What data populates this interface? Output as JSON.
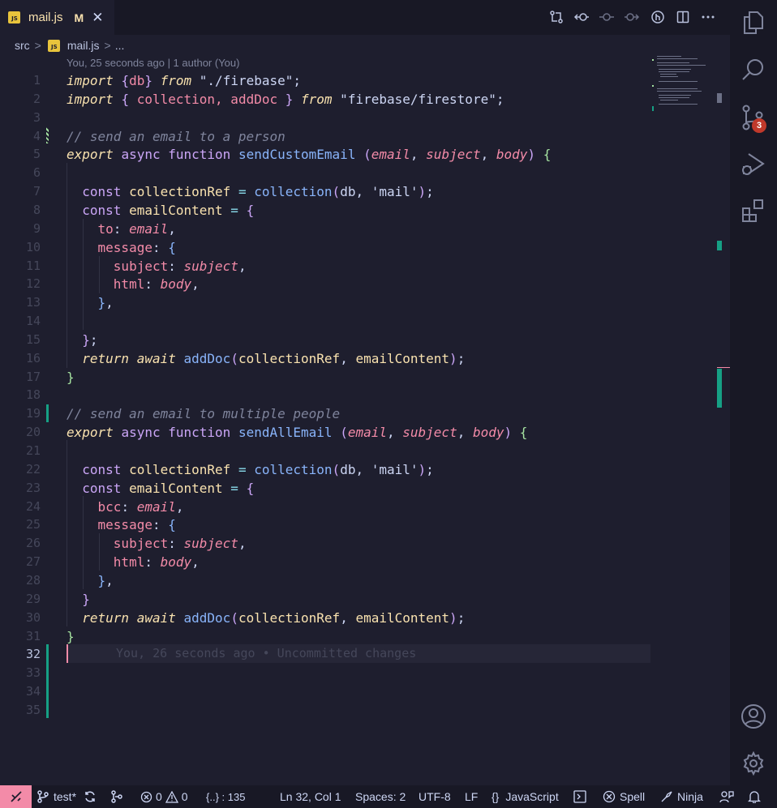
{
  "tab": {
    "badge": "JS",
    "name": "mail.js",
    "modified": "M",
    "close": "✕"
  },
  "toolbar": [
    "compare-changes",
    "open-changes",
    "previous-change",
    "next-change",
    "git-lens",
    "split-editor",
    "more-actions"
  ],
  "breadcrumb": {
    "folder": "src",
    "sep": ">",
    "file": "mail.js",
    "sep2": ">",
    "more": "..."
  },
  "blame_header": "You, 25 seconds ago | 1 author (You)",
  "inline_blame": "You, 26 seconds ago • Uncommitted changes",
  "lines": [
    {
      "n": "1",
      "t": [
        [
          "import",
          "kw"
        ],
        [
          " ",
          "p"
        ],
        [
          "{",
          "br1"
        ],
        [
          "db",
          "var"
        ],
        [
          "}",
          "br1"
        ],
        [
          " ",
          "p"
        ],
        [
          "from",
          "kw"
        ],
        [
          " \"./firebase\"",
          "str"
        ],
        [
          ";",
          "p"
        ]
      ]
    },
    {
      "n": "2",
      "t": [
        [
          "import",
          "kw"
        ],
        [
          " ",
          "p"
        ],
        [
          "{",
          "br1"
        ],
        [
          " collection, addDoc ",
          "var"
        ],
        [
          "}",
          "br1"
        ],
        [
          " ",
          "p"
        ],
        [
          "from",
          "kw"
        ],
        [
          " \"firebase/firestore\"",
          "str"
        ],
        [
          ";",
          "p"
        ]
      ]
    },
    {
      "n": "3",
      "t": []
    },
    {
      "n": "4",
      "t": [
        [
          "// send an email to a person",
          "com"
        ]
      ]
    },
    {
      "n": "5",
      "t": [
        [
          "export",
          "kw"
        ],
        [
          " ",
          "p"
        ],
        [
          "async",
          "key"
        ],
        [
          " ",
          "p"
        ],
        [
          "function",
          "key"
        ],
        [
          " ",
          "p"
        ],
        [
          "sendCustomEmail",
          "fn"
        ],
        [
          " ",
          "p"
        ],
        [
          "(",
          "br1"
        ],
        [
          "email",
          "par"
        ],
        [
          ", ",
          "p"
        ],
        [
          "subject",
          "par"
        ],
        [
          ", ",
          "p"
        ],
        [
          "body",
          "par"
        ],
        [
          ")",
          "br1"
        ],
        [
          " ",
          "p"
        ],
        [
          "{",
          "br2"
        ]
      ]
    },
    {
      "n": "6",
      "t": []
    },
    {
      "n": "7",
      "t": [
        [
          "  ",
          "p"
        ],
        [
          "const",
          "key"
        ],
        [
          " ",
          "p"
        ],
        [
          "collectionRef",
          "prop"
        ],
        [
          " = ",
          "op"
        ],
        [
          "collection",
          "fn"
        ],
        [
          "(",
          "br1"
        ],
        [
          "db",
          "p"
        ],
        [
          ", ",
          "p"
        ],
        [
          "'mail'",
          "str"
        ],
        [
          ")",
          "br1"
        ],
        [
          ";",
          "p"
        ]
      ]
    },
    {
      "n": "8",
      "t": [
        [
          "  ",
          "p"
        ],
        [
          "const",
          "key"
        ],
        [
          " ",
          "p"
        ],
        [
          "emailContent",
          "prop"
        ],
        [
          " = ",
          "op"
        ],
        [
          "{",
          "br1"
        ]
      ]
    },
    {
      "n": "9",
      "t": [
        [
          "    ",
          "p"
        ],
        [
          "to",
          "var"
        ],
        [
          ": ",
          "p"
        ],
        [
          "email",
          "par"
        ],
        [
          ",",
          "p"
        ]
      ]
    },
    {
      "n": "10",
      "t": [
        [
          "    ",
          "p"
        ],
        [
          "message",
          "var"
        ],
        [
          ": ",
          "p"
        ],
        [
          "{",
          "br3"
        ]
      ]
    },
    {
      "n": "11",
      "t": [
        [
          "      ",
          "p"
        ],
        [
          "subject",
          "var"
        ],
        [
          ": ",
          "p"
        ],
        [
          "subject",
          "par"
        ],
        [
          ",",
          "p"
        ]
      ]
    },
    {
      "n": "12",
      "t": [
        [
          "      ",
          "p"
        ],
        [
          "html",
          "var"
        ],
        [
          ": ",
          "p"
        ],
        [
          "body",
          "par"
        ],
        [
          ",",
          "p"
        ]
      ]
    },
    {
      "n": "13",
      "t": [
        [
          "    ",
          "p"
        ],
        [
          "}",
          "br3"
        ],
        [
          ",",
          "p"
        ]
      ]
    },
    {
      "n": "14",
      "t": []
    },
    {
      "n": "15",
      "t": [
        [
          "  ",
          "p"
        ],
        [
          "}",
          "br1"
        ],
        [
          ";",
          "p"
        ]
      ]
    },
    {
      "n": "16",
      "t": [
        [
          "  ",
          "p"
        ],
        [
          "return",
          "kw"
        ],
        [
          " ",
          "p"
        ],
        [
          "await",
          "kw"
        ],
        [
          " ",
          "p"
        ],
        [
          "addDoc",
          "fn"
        ],
        [
          "(",
          "br1"
        ],
        [
          "collectionRef",
          "prop"
        ],
        [
          ", ",
          "p"
        ],
        [
          "emailContent",
          "prop"
        ],
        [
          ")",
          "br1"
        ],
        [
          ";",
          "p"
        ]
      ]
    },
    {
      "n": "17",
      "t": [
        [
          "}",
          "br2"
        ]
      ]
    },
    {
      "n": "18",
      "t": []
    },
    {
      "n": "19",
      "t": [
        [
          "// send an email to multiple people",
          "com"
        ]
      ]
    },
    {
      "n": "20",
      "t": [
        [
          "export",
          "kw"
        ],
        [
          " ",
          "p"
        ],
        [
          "async",
          "key"
        ],
        [
          " ",
          "p"
        ],
        [
          "function",
          "key"
        ],
        [
          " ",
          "p"
        ],
        [
          "sendAllEmail",
          "fn"
        ],
        [
          " ",
          "p"
        ],
        [
          "(",
          "br1"
        ],
        [
          "email",
          "par"
        ],
        [
          ", ",
          "p"
        ],
        [
          "subject",
          "par"
        ],
        [
          ", ",
          "p"
        ],
        [
          "body",
          "par"
        ],
        [
          ")",
          "br1"
        ],
        [
          " ",
          "p"
        ],
        [
          "{",
          "br2"
        ]
      ]
    },
    {
      "n": "21",
      "t": []
    },
    {
      "n": "22",
      "t": [
        [
          "  ",
          "p"
        ],
        [
          "const",
          "key"
        ],
        [
          " ",
          "p"
        ],
        [
          "collectionRef",
          "prop"
        ],
        [
          " = ",
          "op"
        ],
        [
          "collection",
          "fn"
        ],
        [
          "(",
          "br1"
        ],
        [
          "db",
          "p"
        ],
        [
          ", ",
          "p"
        ],
        [
          "'mail'",
          "str"
        ],
        [
          ")",
          "br1"
        ],
        [
          ";",
          "p"
        ]
      ]
    },
    {
      "n": "23",
      "t": [
        [
          "  ",
          "p"
        ],
        [
          "const",
          "key"
        ],
        [
          " ",
          "p"
        ],
        [
          "emailContent",
          "prop"
        ],
        [
          " = ",
          "op"
        ],
        [
          "{",
          "br1"
        ]
      ]
    },
    {
      "n": "24",
      "t": [
        [
          "    ",
          "p"
        ],
        [
          "bcc",
          "var"
        ],
        [
          ": ",
          "p"
        ],
        [
          "email",
          "par"
        ],
        [
          ",",
          "p"
        ]
      ]
    },
    {
      "n": "25",
      "t": [
        [
          "    ",
          "p"
        ],
        [
          "message",
          "var"
        ],
        [
          ": ",
          "p"
        ],
        [
          "{",
          "br3"
        ]
      ]
    },
    {
      "n": "26",
      "t": [
        [
          "      ",
          "p"
        ],
        [
          "subject",
          "var"
        ],
        [
          ": ",
          "p"
        ],
        [
          "subject",
          "par"
        ],
        [
          ",",
          "p"
        ]
      ]
    },
    {
      "n": "27",
      "t": [
        [
          "      ",
          "p"
        ],
        [
          "html",
          "var"
        ],
        [
          ": ",
          "p"
        ],
        [
          "body",
          "par"
        ],
        [
          ",",
          "p"
        ]
      ]
    },
    {
      "n": "28",
      "t": [
        [
          "    ",
          "p"
        ],
        [
          "}",
          "br3"
        ],
        [
          ",",
          "p"
        ]
      ]
    },
    {
      "n": "29",
      "t": [
        [
          "  ",
          "p"
        ],
        [
          "}",
          "br1"
        ]
      ]
    },
    {
      "n": "30",
      "t": [
        [
          "  ",
          "p"
        ],
        [
          "return",
          "kw"
        ],
        [
          " ",
          "p"
        ],
        [
          "await",
          "kw"
        ],
        [
          " ",
          "p"
        ],
        [
          "addDoc",
          "fn"
        ],
        [
          "(",
          "br1"
        ],
        [
          "collectionRef",
          "prop"
        ],
        [
          ", ",
          "p"
        ],
        [
          "emailContent",
          "prop"
        ],
        [
          ")",
          "br1"
        ],
        [
          ";",
          "p"
        ]
      ]
    },
    {
      "n": "31",
      "t": [
        [
          "}",
          "br2"
        ]
      ]
    },
    {
      "n": "32",
      "t": []
    },
    {
      "n": "33",
      "t": []
    },
    {
      "n": "34",
      "t": []
    },
    {
      "n": "35",
      "t": []
    }
  ],
  "colors": {
    "kw": "#f9e2af",
    "key": "#cba6f7",
    "fn": "#89b4fa",
    "par": "#f38ba8",
    "var": "#f38ba8",
    "str": "#cdd6f4",
    "com": "#7f849c",
    "prop": "#f9e2af",
    "op": "#89dceb",
    "p": "#cdd6f4",
    "br1": "#cba6f7",
    "br2": "#a6e3a1",
    "br3": "#89b4fa"
  },
  "activity": {
    "explorer": "explorer-icon",
    "search": "search-icon",
    "scm": "source-control-icon",
    "scm_badge": "3",
    "run": "run-debug-icon",
    "extensions": "extensions-icon",
    "account": "account-icon",
    "settings": "gear-icon"
  },
  "status": {
    "remote": "><",
    "branch": "test*",
    "errors": "0",
    "warnings": "0",
    "symbols": "{..} : 135",
    "position": "Ln 32, Col 1",
    "spaces": "Spaces: 2",
    "encoding": "UTF-8",
    "eol": "LF",
    "lang_icon": "{}",
    "language": "JavaScript",
    "spell": "Spell",
    "ninja": "Ninja"
  }
}
